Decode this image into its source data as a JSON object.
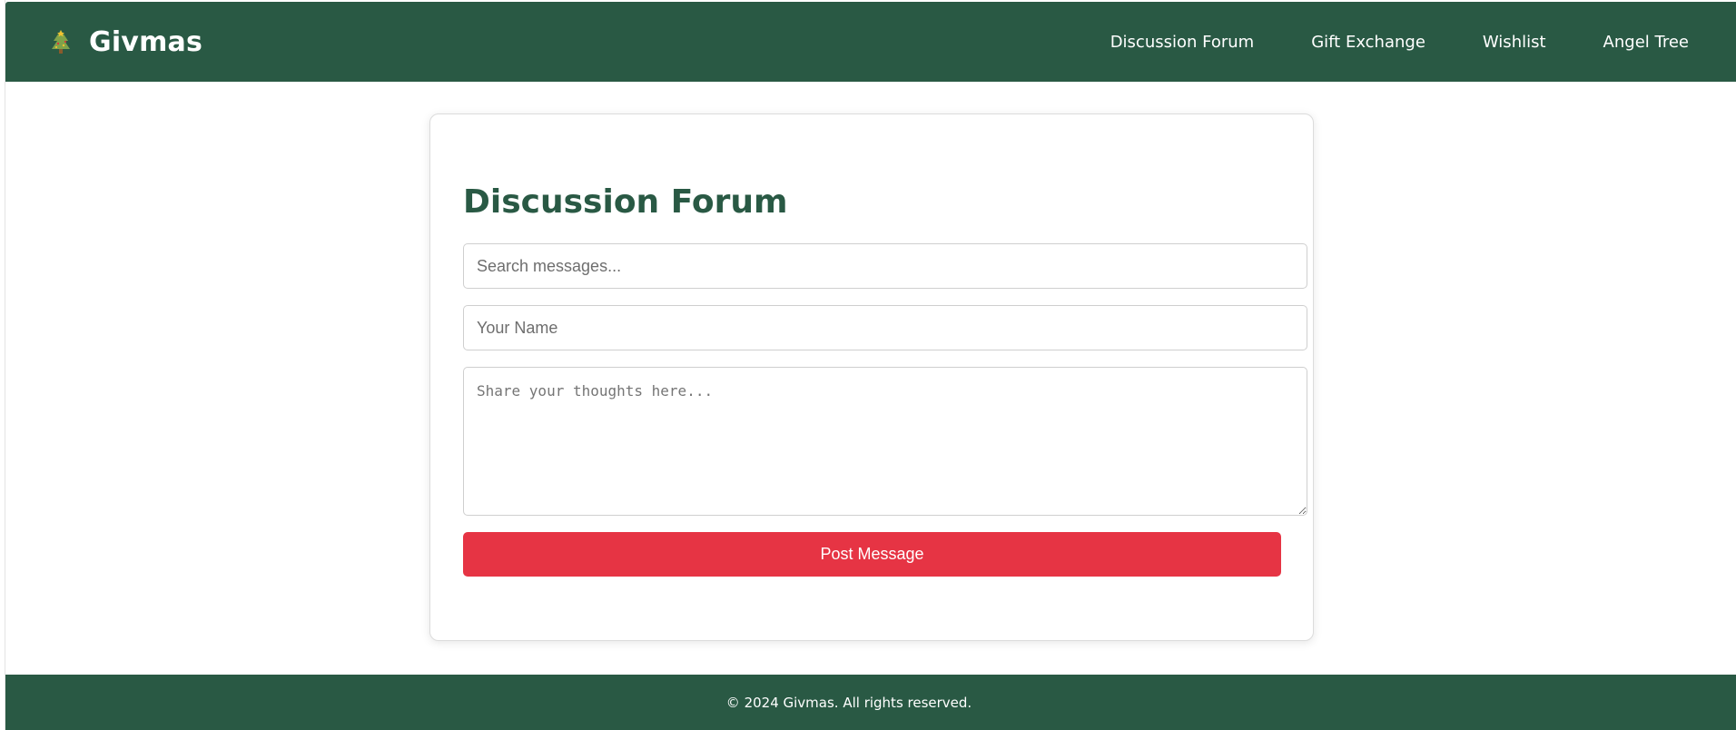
{
  "header": {
    "brand_name": "Givmas",
    "brand_icon": "christmas-tree-icon",
    "nav": [
      {
        "label": "Discussion Forum"
      },
      {
        "label": "Gift Exchange"
      },
      {
        "label": "Wishlist"
      },
      {
        "label": "Angel Tree"
      }
    ]
  },
  "forum": {
    "title": "Discussion Forum",
    "search_placeholder": "Search messages...",
    "name_placeholder": "Your Name",
    "message_placeholder": "Share your thoughts here...",
    "post_button_label": "Post Message"
  },
  "footer": {
    "text": "© 2024 Givmas. All rights reserved."
  },
  "colors": {
    "primary_green": "#295944",
    "accent_red": "#e63444",
    "white": "#ffffff"
  }
}
